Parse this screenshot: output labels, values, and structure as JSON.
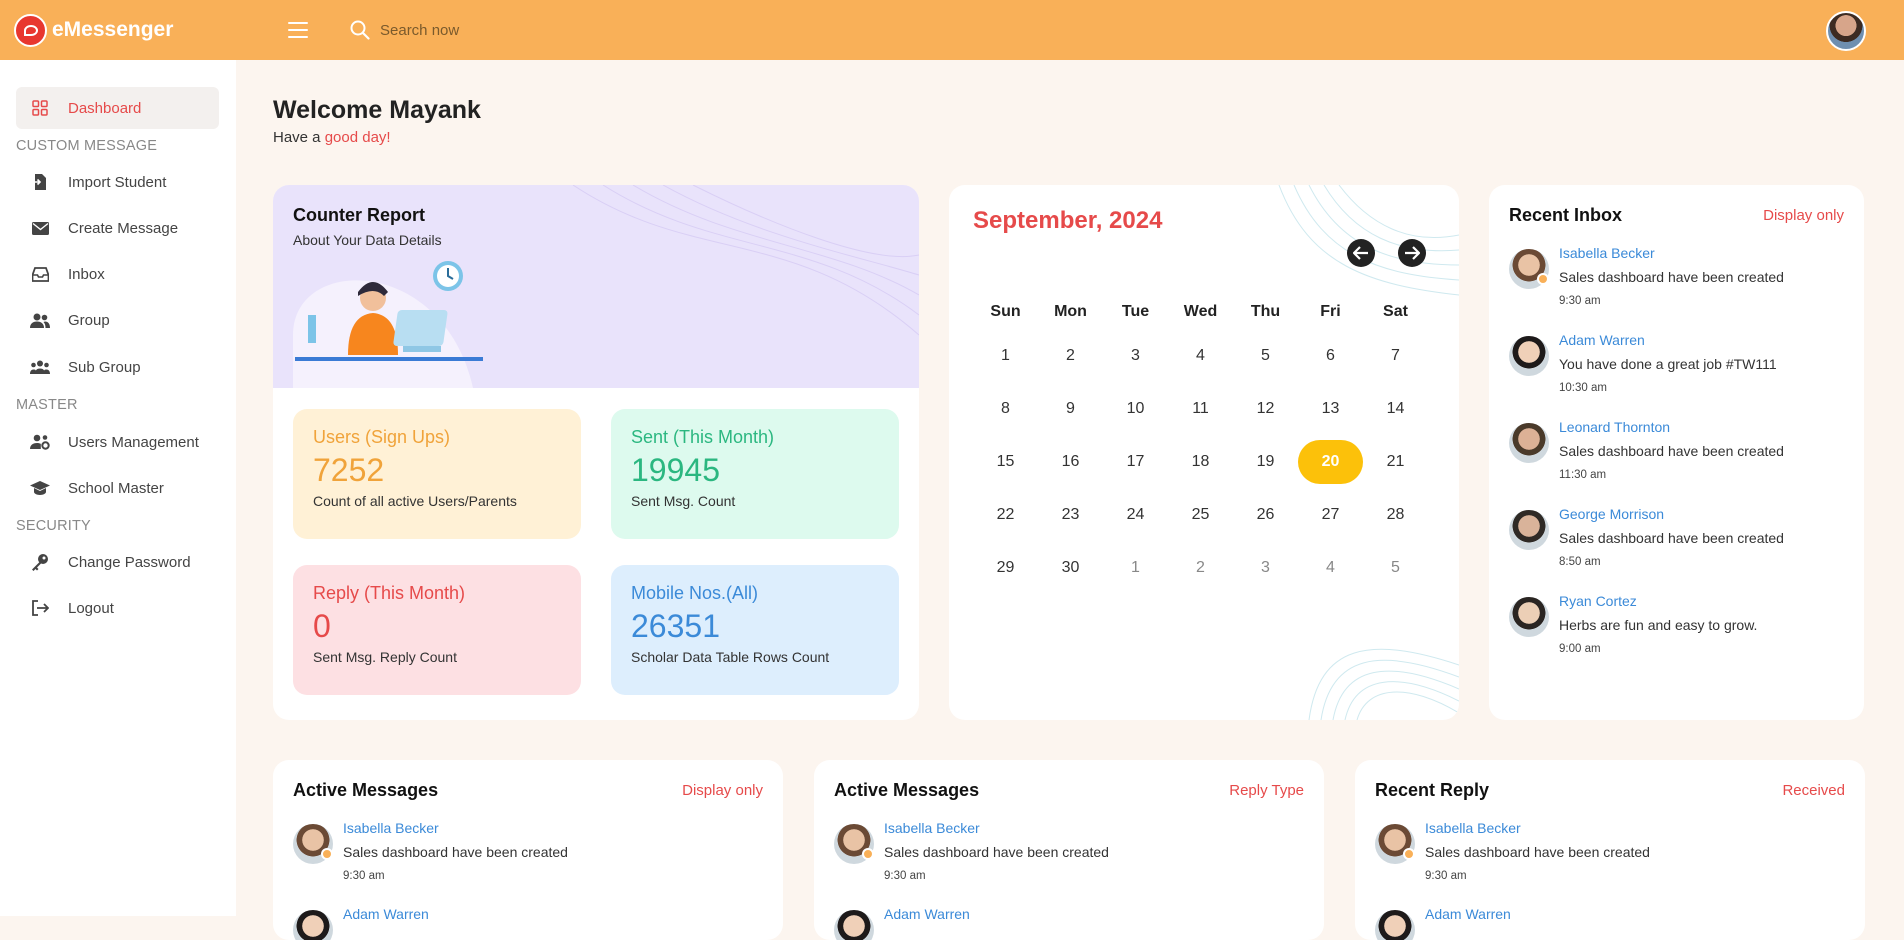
{
  "app": {
    "title": "eMessenger"
  },
  "search": {
    "placeholder": "Search now"
  },
  "colors": {
    "topbar": "#f9b058",
    "accent": "#e64a4a",
    "link": "#3b8ad8",
    "today": "#fcc10a"
  },
  "sidebar": {
    "dashboard": "Dashboard",
    "section_custom": "CUSTOM MESSAGE",
    "import_student": "Import Student",
    "create_message": "Create Message",
    "inbox": "Inbox",
    "group": "Group",
    "sub_group": "Sub Group",
    "section_master": "MASTER",
    "users_management": "Users Management",
    "school_master": "School Master",
    "section_security": "SECURITY",
    "change_password": "Change Password",
    "logout": "Logout"
  },
  "welcome": {
    "title": "Welcome Mayank",
    "prefix": "Have a ",
    "highlight": "good day!"
  },
  "counter": {
    "title": "Counter Report",
    "subtitle": "About Your Data Details",
    "stats": [
      {
        "label": "Users (Sign Ups)",
        "value": "7252",
        "desc": "Count of all active Users/Parents"
      },
      {
        "label": "Sent (This Month)",
        "value": "19945",
        "desc": "Sent Msg. Count"
      },
      {
        "label": "Reply (This Month)",
        "value": "0",
        "desc": "Sent Msg. Reply Count"
      },
      {
        "label": "Mobile Nos.(All)",
        "value": "26351",
        "desc": "Scholar Data Table Rows Count"
      }
    ]
  },
  "calendar": {
    "title": "September, 2024",
    "days": [
      "Sun",
      "Mon",
      "Tue",
      "Wed",
      "Thu",
      "Fri",
      "Sat"
    ],
    "dates": [
      "1",
      "2",
      "3",
      "4",
      "5",
      "6",
      "7",
      "8",
      "9",
      "10",
      "11",
      "12",
      "13",
      "14",
      "15",
      "16",
      "17",
      "18",
      "19",
      "20",
      "21",
      "22",
      "23",
      "24",
      "25",
      "26",
      "27",
      "28",
      "29",
      "30",
      "1",
      "2",
      "3",
      "4",
      "5"
    ],
    "today": "20"
  },
  "recent_inbox": {
    "title": "Recent Inbox",
    "action": "Display only",
    "items": [
      {
        "name": "Isabella Becker",
        "text": "Sales dashboard have been created",
        "time": "9:30 am"
      },
      {
        "name": "Adam Warren",
        "text": "You have done a great job #TW111",
        "time": "10:30 am"
      },
      {
        "name": "Leonard Thornton",
        "text": "Sales dashboard have been created",
        "time": "11:30 am"
      },
      {
        "name": "George Morrison",
        "text": "Sales dashboard have been created",
        "time": "8:50 am"
      },
      {
        "name": "Ryan Cortez",
        "text": "Herbs are fun and easy to grow.",
        "time": "9:00 am"
      }
    ]
  },
  "active_messages_1": {
    "title": "Active Messages",
    "action": "Display only",
    "items": [
      {
        "name": "Isabella Becker",
        "text": "Sales dashboard have been created",
        "time": "9:30 am"
      },
      {
        "name": "Adam Warren",
        "text": "",
        "time": ""
      }
    ]
  },
  "active_messages_2": {
    "title": "Active Messages",
    "action": "Reply Type",
    "items": [
      {
        "name": "Isabella Becker",
        "text": "Sales dashboard have been created",
        "time": "9:30 am"
      },
      {
        "name": "Adam Warren",
        "text": "",
        "time": ""
      }
    ]
  },
  "recent_reply": {
    "title": "Recent Reply",
    "action": "Received",
    "items": [
      {
        "name": "Isabella Becker",
        "text": "Sales dashboard have been created",
        "time": "9:30 am"
      },
      {
        "name": "Adam Warren",
        "text": "",
        "time": ""
      }
    ]
  }
}
